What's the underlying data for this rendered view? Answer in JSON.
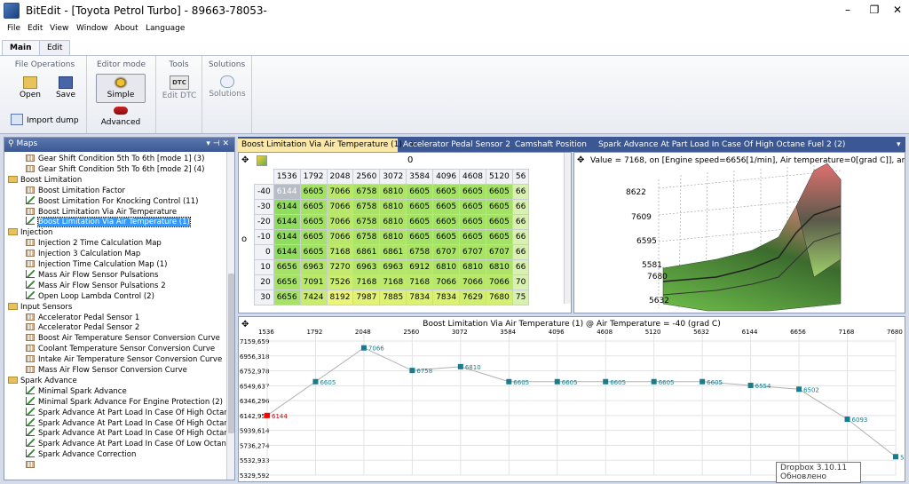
{
  "window": {
    "title": "BitEdit - [Toyota Petrol Turbo] - 89663-78053-",
    "minimize": "–",
    "restore": "❐",
    "close": "✕"
  },
  "menu": [
    "File",
    "Edit",
    "View",
    "Window",
    "About",
    "Language"
  ],
  "ribbon_tabs": [
    "Main",
    "Edit"
  ],
  "ribbon": {
    "file_ops": {
      "title": "File Operations",
      "open": "Open",
      "save": "Save",
      "import": "Import dump"
    },
    "editor_mode": {
      "title": "Editor mode",
      "simple": "Simple",
      "advanced": "Advanced"
    },
    "tools": {
      "title": "Tools",
      "edit_dtc": "Edit DTC",
      "dtc_icon": "DTC"
    },
    "solutions": {
      "title": "Solutions",
      "label": "Solutions"
    }
  },
  "maps_panel": {
    "title": "Maps",
    "pin": "▾ ⊣ ✕",
    "items": [
      {
        "label": "Gear Shift Condition 5th To 6th [mode 1] (3)",
        "kind": "map",
        "level": 2
      },
      {
        "label": "Gear Shift Condition 5th To 6th [mode 2] (4)",
        "kind": "map",
        "level": 2
      },
      {
        "label": "Boost Limitation",
        "kind": "folder",
        "level": 1
      },
      {
        "label": "Boost Limitation Factor",
        "kind": "map",
        "level": 2
      },
      {
        "label": "Boost Limitation For Knocking Control (11)",
        "kind": "curve",
        "level": 2
      },
      {
        "label": "Boost Limitation Via Air Temperature",
        "kind": "map",
        "level": 2
      },
      {
        "label": "Boost Limitation Via Air Temperature (1)",
        "kind": "curve",
        "level": 2,
        "selected": true
      },
      {
        "label": "Injection",
        "kind": "folder",
        "level": 1
      },
      {
        "label": "Injection 2 Time Calculation Map",
        "kind": "map",
        "level": 2
      },
      {
        "label": "Injection 3 Calculation Map",
        "kind": "map",
        "level": 2
      },
      {
        "label": "Injection Time Calculation Map (1)",
        "kind": "map",
        "level": 2
      },
      {
        "label": "Mass Air Flow Sensor Pulsations",
        "kind": "curve",
        "level": 2
      },
      {
        "label": "Mass Air Flow Sensor Pulsations 2",
        "kind": "curve",
        "level": 2
      },
      {
        "label": "Open Loop Lambda Control (2)",
        "kind": "curve",
        "level": 2
      },
      {
        "label": "Input Sensors",
        "kind": "folder",
        "level": 1
      },
      {
        "label": "Accelerator Pedal Sensor 1",
        "kind": "map",
        "level": 2
      },
      {
        "label": "Accelerator Pedal Sensor 2",
        "kind": "map",
        "level": 2
      },
      {
        "label": "Boost Air Temperature Sensor Conversion Curve",
        "kind": "map",
        "level": 2
      },
      {
        "label": "Coolant Temperature Sensor Conversion Curve",
        "kind": "map",
        "level": 2
      },
      {
        "label": "Intake Air Temperature Sensor Conversion Curve",
        "kind": "map",
        "level": 2
      },
      {
        "label": "Mass Air Flow Sensor Conversion Curve",
        "kind": "map",
        "level": 2
      },
      {
        "label": "Spark Advance",
        "kind": "folder",
        "level": 1
      },
      {
        "label": "Minimal Spark Advance",
        "kind": "curve",
        "level": 2
      },
      {
        "label": "Minimal Spark Advance For Engine Protection (2)",
        "kind": "curve",
        "level": 2
      },
      {
        "label": "Spark Advance At Part Load In Case Of High Octane",
        "kind": "curve",
        "level": 2
      },
      {
        "label": "Spark Advance At Part Load In Case Of High Octane",
        "kind": "curve",
        "level": 2
      },
      {
        "label": "Spark Advance At Part Load In Case Of High Octane",
        "kind": "curve",
        "level": 2
      },
      {
        "label": "Spark Advance At Part Load In Case Of Low Octane F",
        "kind": "curve",
        "level": 2
      },
      {
        "label": "Spark Advance Correction",
        "kind": "curve",
        "level": 2
      },
      {
        "label": "",
        "kind": "map",
        "level": 2
      }
    ]
  },
  "doc_tabs": [
    {
      "label": "Boost Limitation Via Air Temperature (1)",
      "active": true,
      "close": "✕"
    },
    {
      "label": "Accelerator Pedal Sensor 2"
    },
    {
      "label": "Camshaft Position"
    },
    {
      "label": "Spark Advance At Part Load In Case Of High Octane Fuel 2 (2)"
    }
  ],
  "doc_tabs_menu": "▾",
  "grid": {
    "header_value": "0",
    "cols": [
      "1536",
      "1792",
      "2048",
      "2560",
      "3072",
      "3584",
      "4096",
      "4608",
      "5120",
      "56"
    ],
    "rows": [
      {
        "r": "-40",
        "v": [
          "6144",
          "6605",
          "7066",
          "6758",
          "6810",
          "6605",
          "6605",
          "6605",
          "6605",
          "66"
        ]
      },
      {
        "r": "-30",
        "v": [
          "6144",
          "6605",
          "7066",
          "6758",
          "6810",
          "6605",
          "6605",
          "6605",
          "6605",
          "66"
        ]
      },
      {
        "r": "-20",
        "v": [
          "6144",
          "6605",
          "7066",
          "6758",
          "6810",
          "6605",
          "6605",
          "6605",
          "6605",
          "66"
        ]
      },
      {
        "r": "-10",
        "v": [
          "6144",
          "6605",
          "7066",
          "6758",
          "6810",
          "6605",
          "6605",
          "6605",
          "6605",
          "66"
        ]
      },
      {
        "r": "0",
        "v": [
          "6144",
          "6605",
          "7168",
          "6861",
          "6861",
          "6758",
          "6707",
          "6707",
          "6707",
          "66"
        ]
      },
      {
        "r": "10",
        "v": [
          "6656",
          "6963",
          "7270",
          "6963",
          "6963",
          "6912",
          "6810",
          "6810",
          "6810",
          "66"
        ]
      },
      {
        "r": "20",
        "v": [
          "6656",
          "7091",
          "7526",
          "7168",
          "7168",
          "7168",
          "7066",
          "7066",
          "7066",
          "70"
        ]
      },
      {
        "r": "30",
        "v": [
          "6656",
          "7424",
          "8192",
          "7987",
          "7885",
          "7834",
          "7834",
          "7629",
          "7680",
          "75"
        ]
      }
    ],
    "row_axis_label": "o"
  },
  "plot3d": {
    "readout": "Value = 7168, on [Engine speed=6656[1/min], Air temperature=0[grad C]], angle=-1,83",
    "zticks": [
      "8622",
      "7609",
      "6595",
      "5581",
      "7680",
      "5632"
    ]
  },
  "chart_data": {
    "type": "line",
    "title": "Boost Limitation Via Air Temperature (1) @ Air Temperature = -40 (grad C)",
    "x": [
      "1536",
      "1792",
      "2048",
      "2560",
      "3072",
      "3584",
      "4096",
      "4608",
      "5120",
      "5632",
      "6144",
      "6656",
      "7168",
      "7680"
    ],
    "values": [
      6144,
      6605,
      7066,
      6758,
      6810,
      6605,
      6605,
      6605,
      6605,
      6605,
      6554,
      6502,
      6093,
      5581
    ],
    "yticks": [
      "7159,659",
      "6956,318",
      "6752,978",
      "6549,637",
      "6346,296",
      "6142,955",
      "5939,614",
      "5736,274",
      "5532,933",
      "5329,592"
    ],
    "ylim": [
      5329.592,
      7159.659
    ],
    "grid": true,
    "highlight_color": "#ff0000",
    "marker_color": "#197c8c"
  },
  "tooltip": {
    "line1": "Dropbox 3.10.11",
    "line2": "Обновлено"
  }
}
